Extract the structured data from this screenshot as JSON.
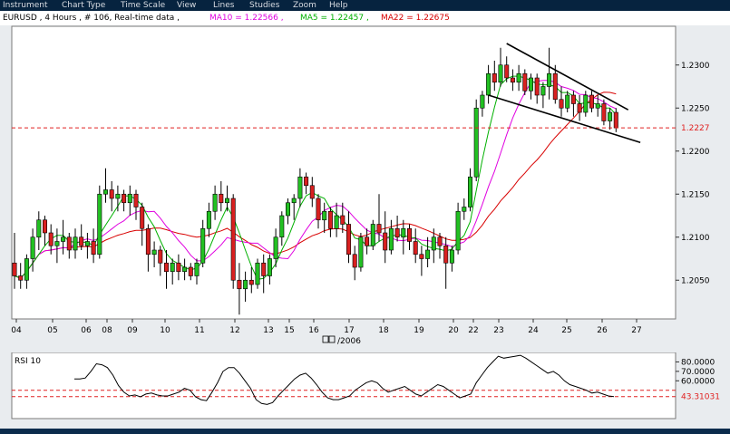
{
  "menu": [
    "Instrument",
    "Chart Type",
    "Time Scale",
    "View",
    "Lines",
    "Studies",
    "Zoom",
    "Help"
  ],
  "header": {
    "instrument": "EURUSD , 4 Hours , # 106, Real-time data ,",
    "ma10_label": "MA10 = 1.22566 ,",
    "ma5_label": "MA5 = 1.22457 ,",
    "ma22_label": "MA22 = 1.22675"
  },
  "colors": {
    "ma10": "#e000e0",
    "ma5": "#00b000",
    "ma22": "#d80000",
    "up": "#22c022",
    "down": "#d82020",
    "grid_bg": "#ffffff",
    "frame_bg": "#e9ecef",
    "menu_bg": "#06233f"
  },
  "chart_data": [
    {
      "type": "candlestick",
      "title": "EURUSD , 4 Hours",
      "ylim": [
        1.2005,
        1.2345
      ],
      "y_ticks": [
        "1.2300",
        "1.2250",
        "1.2200",
        "1.2150",
        "1.2100",
        "1.2050"
      ],
      "x_ticks": [
        "04",
        "05",
        "06",
        "08",
        "09",
        "10",
        "11",
        "12",
        "13",
        "15",
        "16",
        "17",
        "18",
        "19",
        "20",
        "22",
        "23",
        "24",
        "25",
        "26",
        "27"
      ],
      "x_axis_label": "/2006",
      "current_price_label": "1.2227",
      "current_price": 1.2227,
      "candles": [
        [
          1.207,
          1.2105,
          1.204,
          1.2055
        ],
        [
          1.2055,
          1.207,
          1.204,
          1.205
        ],
        [
          1.205,
          1.208,
          1.204,
          1.2075
        ],
        [
          1.2075,
          1.211,
          1.206,
          1.21
        ],
        [
          1.21,
          1.213,
          1.2085,
          1.212
        ],
        [
          1.212,
          1.2125,
          1.209,
          1.2105
        ],
        [
          1.2105,
          1.2115,
          1.208,
          1.209
        ],
        [
          1.209,
          1.211,
          1.207,
          1.2095
        ],
        [
          1.2095,
          1.212,
          1.208,
          1.21
        ],
        [
          1.21,
          1.2105,
          1.2075,
          1.2085
        ],
        [
          1.2085,
          1.211,
          1.2075,
          1.21
        ],
        [
          1.21,
          1.2115,
          1.2085,
          1.209
        ],
        [
          1.209,
          1.2105,
          1.2075,
          1.2095
        ],
        [
          1.2095,
          1.211,
          1.207,
          1.208
        ],
        [
          1.208,
          1.216,
          1.2075,
          1.215
        ],
        [
          1.215,
          1.218,
          1.214,
          1.2155
        ],
        [
          1.2155,
          1.2165,
          1.213,
          1.2145
        ],
        [
          1.2145,
          1.216,
          1.213,
          1.215
        ],
        [
          1.215,
          1.2155,
          1.213,
          1.214
        ],
        [
          1.214,
          1.216,
          1.2125,
          1.215
        ],
        [
          1.215,
          1.2155,
          1.212,
          1.2135
        ],
        [
          1.2135,
          1.214,
          1.209,
          1.211
        ],
        [
          1.211,
          1.2115,
          1.206,
          1.208
        ],
        [
          1.208,
          1.2095,
          1.2065,
          1.2085
        ],
        [
          1.2085,
          1.209,
          1.2055,
          1.207
        ],
        [
          1.207,
          1.2085,
          1.204,
          1.206
        ],
        [
          1.206,
          1.2075,
          1.2045,
          1.207
        ],
        [
          1.207,
          1.208,
          1.205,
          1.206
        ],
        [
          1.206,
          1.2075,
          1.205,
          1.2065
        ],
        [
          1.2065,
          1.207,
          1.205,
          1.2055
        ],
        [
          1.2055,
          1.2075,
          1.2045,
          1.207
        ],
        [
          1.207,
          1.212,
          1.2065,
          1.211
        ],
        [
          1.211,
          1.214,
          1.21,
          1.213
        ],
        [
          1.213,
          1.216,
          1.212,
          1.215
        ],
        [
          1.215,
          1.2165,
          1.213,
          1.214
        ],
        [
          1.214,
          1.216,
          1.213,
          1.2145
        ],
        [
          1.2145,
          1.215,
          1.204,
          1.205
        ],
        [
          1.205,
          1.207,
          1.201,
          1.204
        ],
        [
          1.204,
          1.206,
          1.2025,
          1.205
        ],
        [
          1.205,
          1.2065,
          1.2035,
          1.2045
        ],
        [
          1.2045,
          1.2075,
          1.204,
          1.207
        ],
        [
          1.207,
          1.208,
          1.2035,
          1.2055
        ],
        [
          1.2055,
          1.208,
          1.2045,
          1.2075
        ],
        [
          1.2075,
          1.211,
          1.2065,
          1.21
        ],
        [
          1.21,
          1.213,
          1.209,
          1.2125
        ],
        [
          1.2125,
          1.2145,
          1.2115,
          1.214
        ],
        [
          1.214,
          1.215,
          1.212,
          1.2145
        ],
        [
          1.2145,
          1.218,
          1.2135,
          1.217
        ],
        [
          1.217,
          1.2175,
          1.215,
          1.216
        ],
        [
          1.216,
          1.217,
          1.2135,
          1.2145
        ],
        [
          1.2145,
          1.215,
          1.211,
          1.212
        ],
        [
          1.212,
          1.214,
          1.2105,
          1.213
        ],
        [
          1.213,
          1.2135,
          1.21,
          1.211
        ],
        [
          1.211,
          1.214,
          1.21,
          1.2125
        ],
        [
          1.2125,
          1.214,
          1.2105,
          1.2115
        ],
        [
          1.2115,
          1.213,
          1.207,
          1.208
        ],
        [
          1.208,
          1.209,
          1.205,
          1.2065
        ],
        [
          1.2065,
          1.2105,
          1.206,
          1.21
        ],
        [
          1.21,
          1.211,
          1.208,
          1.209
        ],
        [
          1.209,
          1.212,
          1.2085,
          1.2115
        ],
        [
          1.2115,
          1.215,
          1.2095,
          1.2105
        ],
        [
          1.2105,
          1.213,
          1.207,
          1.2085
        ],
        [
          1.2085,
          1.212,
          1.208,
          1.211
        ],
        [
          1.211,
          1.2125,
          1.2095,
          1.21
        ],
        [
          1.21,
          1.212,
          1.208,
          1.211
        ],
        [
          1.211,
          1.2115,
          1.2085,
          1.2095
        ],
        [
          1.2095,
          1.211,
          1.207,
          1.208
        ],
        [
          1.208,
          1.209,
          1.2055,
          1.2075
        ],
        [
          1.2075,
          1.21,
          1.2065,
          1.2085
        ],
        [
          1.2085,
          1.211,
          1.207,
          1.21
        ],
        [
          1.21,
          1.2105,
          1.2075,
          1.209
        ],
        [
          1.209,
          1.21,
          1.204,
          1.207
        ],
        [
          1.207,
          1.209,
          1.206,
          1.2085
        ],
        [
          1.2085,
          1.214,
          1.208,
          1.213
        ],
        [
          1.213,
          1.2145,
          1.212,
          1.2135
        ],
        [
          1.2135,
          1.218,
          1.213,
          1.217
        ],
        [
          1.217,
          1.226,
          1.2165,
          1.225
        ],
        [
          1.225,
          1.227,
          1.224,
          1.2265
        ],
        [
          1.2265,
          1.23,
          1.2255,
          1.229
        ],
        [
          1.229,
          1.2305,
          1.227,
          1.228
        ],
        [
          1.228,
          1.232,
          1.2275,
          1.23
        ],
        [
          1.23,
          1.231,
          1.228,
          1.2285
        ],
        [
          1.2285,
          1.2295,
          1.227,
          1.228
        ],
        [
          1.228,
          1.23,
          1.227,
          1.229
        ],
        [
          1.229,
          1.2295,
          1.2265,
          1.227
        ],
        [
          1.227,
          1.229,
          1.226,
          1.2285
        ],
        [
          1.2285,
          1.229,
          1.2255,
          1.2265
        ],
        [
          1.2265,
          1.228,
          1.225,
          1.2275
        ],
        [
          1.2275,
          1.232,
          1.226,
          1.229
        ],
        [
          1.229,
          1.23,
          1.2255,
          1.226
        ],
        [
          1.226,
          1.2275,
          1.224,
          1.225
        ],
        [
          1.225,
          1.227,
          1.2245,
          1.2265
        ],
        [
          1.2265,
          1.227,
          1.224,
          1.2255
        ],
        [
          1.2255,
          1.2265,
          1.2235,
          1.2245
        ],
        [
          1.2245,
          1.227,
          1.224,
          1.2265
        ],
        [
          1.2265,
          1.227,
          1.2245,
          1.225
        ],
        [
          1.225,
          1.2265,
          1.224,
          1.2255
        ],
        [
          1.2255,
          1.226,
          1.223,
          1.2235
        ],
        [
          1.2235,
          1.225,
          1.2225,
          1.2245
        ],
        [
          1.2245,
          1.225,
          1.2222,
          1.2227
        ]
      ],
      "trendlines": [
        {
          "from": [
            81,
            1.2325
          ],
          "to": [
            101,
            1.2248
          ]
        },
        {
          "from": [
            78,
            1.2265
          ],
          "to": [
            103,
            1.221
          ]
        }
      ]
    },
    {
      "type": "line",
      "title": "RSI 10",
      "ylim": [
        20,
        90
      ],
      "y_ticks": [
        "80.0000",
        "70.0000",
        "60.0000"
      ],
      "current_label": "43.31031",
      "reference_lines": [
        50,
        43.31
      ],
      "values": [
        62,
        62,
        63,
        70,
        78,
        77,
        74,
        66,
        55,
        48,
        44,
        45,
        43,
        46,
        47,
        45,
        44,
        44,
        46,
        48,
        52,
        50,
        43,
        40,
        39,
        48,
        58,
        70,
        74,
        74,
        68,
        60,
        52,
        40,
        36,
        35,
        37,
        44,
        50,
        56,
        62,
        66,
        68,
        63,
        56,
        48,
        42,
        40,
        40,
        42,
        44,
        50,
        54,
        58,
        60,
        58,
        52,
        48,
        50,
        52,
        54,
        50,
        46,
        44,
        48,
        52,
        56,
        54,
        50,
        46,
        42,
        44,
        46,
        58,
        66,
        74,
        80,
        86,
        84,
        85,
        86,
        87,
        84,
        80,
        76,
        72,
        68,
        70,
        66,
        60,
        56,
        54,
        52,
        50,
        47,
        48,
        46,
        44,
        43.3
      ]
    }
  ]
}
